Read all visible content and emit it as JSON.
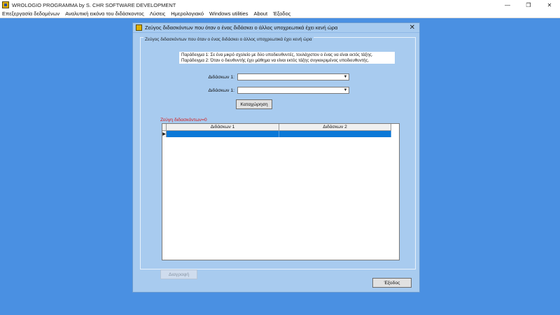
{
  "app": {
    "title": "WROLOGIO PROGRAMMA by S. CHR SOFTWARE DEVELOPMENT",
    "minimize": "—",
    "restore": "❐",
    "close": "✕"
  },
  "menu": [
    "Επεξεργασία δεδομένων",
    "Αναλυτική εικόνα του διδάσκοντος",
    "Λύσεις",
    "Ημερολογιακό",
    "Windows utilities",
    "About",
    "Έξοδος"
  ],
  "dialog": {
    "title": "Ζεύγος διδασκόντων που όταν ο ένας διδάσκει ο άλλος υποχρεωτικά έχει κενή ώρα",
    "close": "✕",
    "group_label": "Ζεύγος διδασκόντων που όταν ο ένας διδάσκει ο άλλος υποχρεωτικά έχει κενή ώρα",
    "examples": [
      "Παράδειγμα 1: Σε ένα μικρό σχολείο με δύο υποδιευθυντές, τουλάχιστον ο ένας να είναι εκτός τάξης.",
      "Παράδειγμα 2: Όταν ο διευθυντής έχει μάθημα να είναι εκτός τάξης συγκεκριμένος υποδιευθυντής."
    ],
    "field1_label": "Διδάσκων 1:",
    "field1_value": "",
    "field2_label": "Διδάσκων 1:",
    "field2_value": "",
    "combo_arrow": "▼",
    "submit_label": "Καταχώρηση",
    "count_label": "Ζεύγη διδασκόντων=0",
    "grid": {
      "columns": [
        "Διδάσκων 1",
        "Διδάσκων 2"
      ],
      "row_marker": "▶"
    },
    "delete_label": "Διαγραφή",
    "exit_label": "Έξοδος"
  }
}
